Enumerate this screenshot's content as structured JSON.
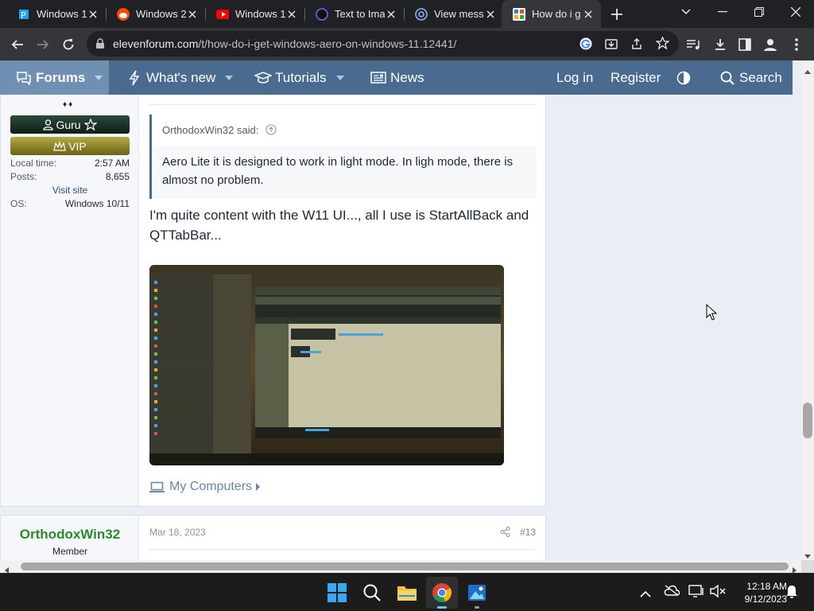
{
  "browser": {
    "tabs": [
      {
        "title": "Windows 1",
        "icon": "pinterest-like-icon"
      },
      {
        "title": "Windows 2",
        "icon": "reddit-icon"
      },
      {
        "title": "Windows 1",
        "icon": "youtube-icon"
      },
      {
        "title": "Text to Ima",
        "icon": "ai-circle-icon"
      },
      {
        "title": "View messa",
        "icon": "at-sign-icon"
      },
      {
        "title": "How do i g",
        "icon": "elevenforum-icon"
      }
    ],
    "url_host": "elevenforum.com",
    "url_path": "/t/how-do-i-get-windows-aero-on-windows-11.12441/"
  },
  "nav": {
    "forums": "Forums",
    "whats_new": "What's new",
    "tutorials": "Tutorials",
    "news": "News",
    "login": "Log in",
    "register": "Register",
    "search": "Search"
  },
  "post1": {
    "user_rank": "Guru",
    "vip": "VIP",
    "stats": [
      {
        "label": "Local time:",
        "value": "2:57 AM"
      },
      {
        "label": "Posts:",
        "value": "8,655"
      },
      {
        "label": "OS:",
        "value": "Windows 10/11"
      }
    ],
    "visit_site": "Visit site",
    "quote_author": "OrthodoxWin32 said:",
    "quote_text": "Aero Lite it is designed to work in light mode. In ligh mode, there is almost no problem.",
    "message": "I'm quite content with the W11 UI..., all I use is StartAllBack and QTTabBar...",
    "my_computers": "My Computers"
  },
  "post2": {
    "username": "OrthodoxWin32",
    "user_title": "Member",
    "date": "Mar 18, 2023",
    "post_number": "#13"
  },
  "taskbar": {
    "time": "12:18 AM",
    "date": "9/12/2023"
  },
  "colors": {
    "nav_bg": "#4a6b8f",
    "nav_active": "#6f8fb3",
    "link": "#4a6b8f",
    "username_green": "#2a8a2a"
  }
}
